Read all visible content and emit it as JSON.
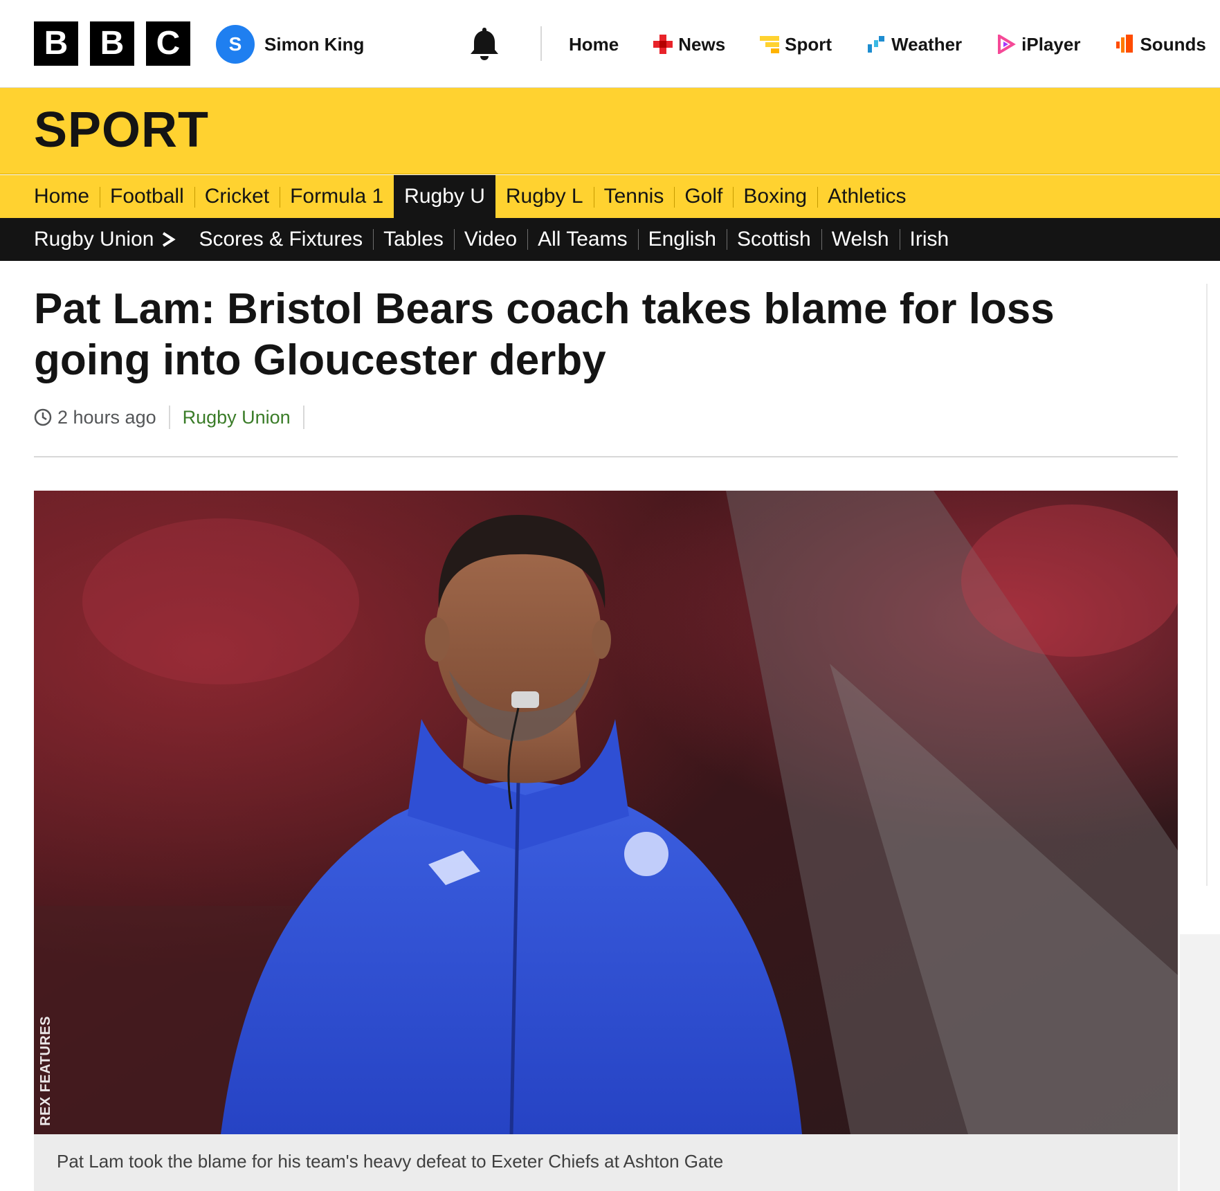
{
  "masthead": {
    "logo_letters": [
      "B",
      "B",
      "C"
    ],
    "account": {
      "initial": "S",
      "name": "Simon King"
    },
    "notifications_icon": "bell-icon",
    "nav": [
      {
        "label": "Home",
        "icon": ""
      },
      {
        "label": "News",
        "icon": "news-icon",
        "color": "#e8232a"
      },
      {
        "label": "Sport",
        "icon": "sport-icon",
        "color": "#ffd230"
      },
      {
        "label": "Weather",
        "icon": "weather-icon",
        "color": "#1e8dd0"
      },
      {
        "label": "iPlayer",
        "icon": "iplayer-icon",
        "color": "#f54997"
      },
      {
        "label": "Sounds",
        "icon": "sounds-icon",
        "color": "#ff4c00"
      }
    ]
  },
  "sport": {
    "title": "SPORT",
    "nav": [
      "Home",
      "Football",
      "Cricket",
      "Formula 1",
      "Rugby U",
      "Rugby L",
      "Tennis",
      "Golf",
      "Boxing",
      "Athletics"
    ],
    "active": "Rugby U"
  },
  "subnav": {
    "parent": "Rugby Union",
    "items": [
      "Scores & Fixtures",
      "Tables",
      "Video",
      "All Teams",
      "English",
      "Scottish",
      "Welsh",
      "Irish"
    ]
  },
  "article": {
    "headline": "Pat Lam: Bristol Bears coach takes blame for loss going into Gloucester derby",
    "time": "2 hours ago",
    "topic": "Rugby Union",
    "image_credit": "REX FEATURES",
    "caption": "Pat Lam took the blame for his team's heavy defeat to Exeter Chiefs at Ashton Gate"
  },
  "colors": {
    "sport_yellow": "#ffd230",
    "black": "#141414",
    "topic_green": "#3a7c28",
    "avatar_blue": "#1f7ff0"
  }
}
